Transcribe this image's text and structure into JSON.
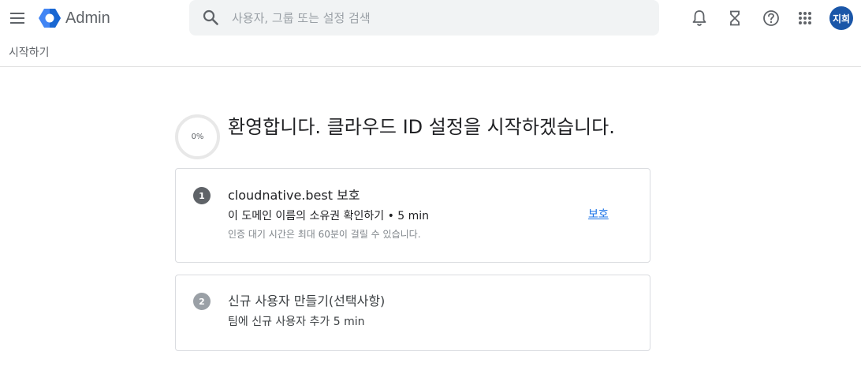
{
  "header": {
    "app_name": "Admin",
    "search": {
      "placeholder": "사용자, 그룹 또는 설정 검색"
    },
    "icons": [
      "menu-icon",
      "admin-logo-icon",
      "search-icon",
      "bell-icon",
      "hourglass-icon",
      "help-icon",
      "apps-grid-icon"
    ],
    "avatar": {
      "initials": "지희",
      "color": "#1a56a8"
    }
  },
  "breadcrumb": {
    "label": "시작하기"
  },
  "setup": {
    "progress": "0%",
    "title": "환영합니다. 클라우드 ID 설정을 시작하겠습니다.",
    "steps": [
      {
        "number": "1",
        "title": "cloudnative.best 보호",
        "description": "이 도메인 이름의 소유권 확인하기 • 5 min",
        "note": "인증 대기 시간은 최대 60분이 걸릴 수 있습니다.",
        "action": "보호"
      },
      {
        "number": "2",
        "title": "신규 사용자 만들기(선택사항)",
        "description": "팀에 신규 사용자 추가 5 min"
      }
    ]
  },
  "colors": {
    "accent": "#1a73e8",
    "logo_blue": "#4285f4",
    "avatar": "#1a56a8"
  }
}
